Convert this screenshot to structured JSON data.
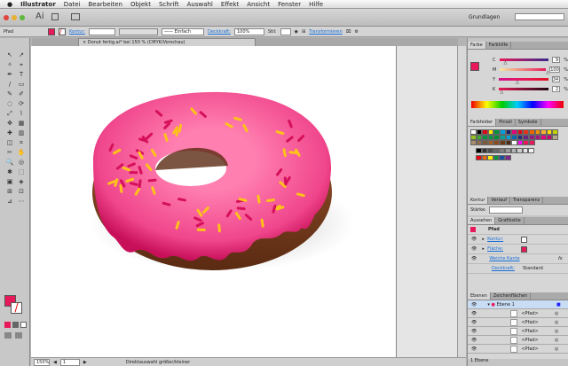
{
  "menubar": {
    "app": "Illustrator",
    "items": [
      "Datei",
      "Bearbeiten",
      "Objekt",
      "Schrift",
      "Auswahl",
      "Effekt",
      "Ansicht",
      "Fenster",
      "Hilfe"
    ]
  },
  "appbar": {
    "logo": "Ai",
    "workspace": "Grundlagen",
    "search_placeholder": ""
  },
  "control": {
    "object": "Pfad",
    "stroke_label": "Kontur:",
    "stroke_style": "Einfach",
    "opacity_label": "Deckkraft:",
    "opacity": "100%",
    "style_label": "Stil:",
    "transform_label": "Transformieren"
  },
  "document": {
    "tab": "Donut fertig.ai* bei 150 % (CMYK/Vorschau)"
  },
  "status": {
    "zoom": "150%",
    "page": "1",
    "tool": "Direktauswahl größer/kleiner"
  },
  "color_panel": {
    "tabs": [
      "Farbe",
      "Farbhilfe"
    ],
    "channels": [
      {
        "label": "C",
        "value": "9",
        "pct": 0.09,
        "grad": "linear-gradient(90deg,#e8195a,#3a2a8a)"
      },
      {
        "label": "M",
        "value": "100",
        "pct": 1.0,
        "grad": "linear-gradient(90deg,#f6e8a0,#e8195a)"
      },
      {
        "label": "Y",
        "value": "34",
        "pct": 0.34,
        "grad": "linear-gradient(90deg,#d0148a,#e8195a,#e01020)"
      },
      {
        "label": "K",
        "value": "2",
        "pct": 0.02,
        "grad": "linear-gradient(90deg,#e8195a,#200810)"
      }
    ],
    "unit": "%",
    "fill": "#e8195a"
  },
  "swatches_panel": {
    "tabs": [
      "Farbfelder",
      "Pinsel",
      "Symbole"
    ],
    "colors": [
      "#ffffff",
      "#000000",
      "#e30613",
      "#ffed00",
      "#009640",
      "#00a0e3",
      "#1d1d6b",
      "#e6007e",
      "#e30613",
      "#e5331a",
      "#ec6608",
      "#f39200",
      "#f9b233",
      "#ffde00",
      "#c6d300",
      "#95c11f",
      "#3aaa35",
      "#009640",
      "#00963f",
      "#008d36",
      "#00a19a",
      "#009fe3",
      "#0069b4",
      "#2a2d7c",
      "#662483",
      "#951b81",
      "#a61680",
      "#e6007e",
      "#c5007a",
      "#b5aa8a",
      "#a98b6e",
      "#936a4e",
      "#7e5a3c",
      "#a65f1e",
      "#8a4b19",
      "#6a3a18",
      "#4a2a12",
      "#ffffff",
      "#f0f",
      "#e8195a",
      "#e8195a"
    ],
    "grays": [
      "#000000",
      "#333333",
      "#4d4d4d",
      "#666666",
      "#808080",
      "#999999",
      "#b3b3b3",
      "#cccccc",
      "#e6e6e6",
      "#f2f2f2"
    ],
    "group": [
      "#e30613",
      "#ec6608",
      "#ffed00",
      "#009640",
      "#1d4f9c",
      "#7b2a8c"
    ]
  },
  "stroke_panel": {
    "tabs": [
      "Kontur",
      "Verlauf",
      "Transparenz"
    ],
    "weight_label": "Stärke:"
  },
  "appearance_panel": {
    "tabs": [
      "Aussehen",
      "Grafikstile"
    ],
    "title": "Pfad",
    "rows": [
      "Kontur:",
      "Fläche:",
      "Weiche Kante"
    ],
    "opacity_label": "Deckkraft:",
    "opacity_value": "Standard",
    "fx": "fx"
  },
  "layers_panel": {
    "tabs": [
      "Ebenen",
      "Zeichenflächen"
    ],
    "layer": "Ebene 1",
    "items": [
      "<Pfad>",
      "<Pfad>",
      "<Pfad>",
      "<Pfad>",
      "<Pfad>"
    ],
    "footer": "1 Ebene"
  },
  "donut": {
    "icing": "#f0468c",
    "dough": "#8a4a2a",
    "sprinkle_pink": "#d6105a",
    "sprinkle_yellow": "#ffc21a"
  }
}
